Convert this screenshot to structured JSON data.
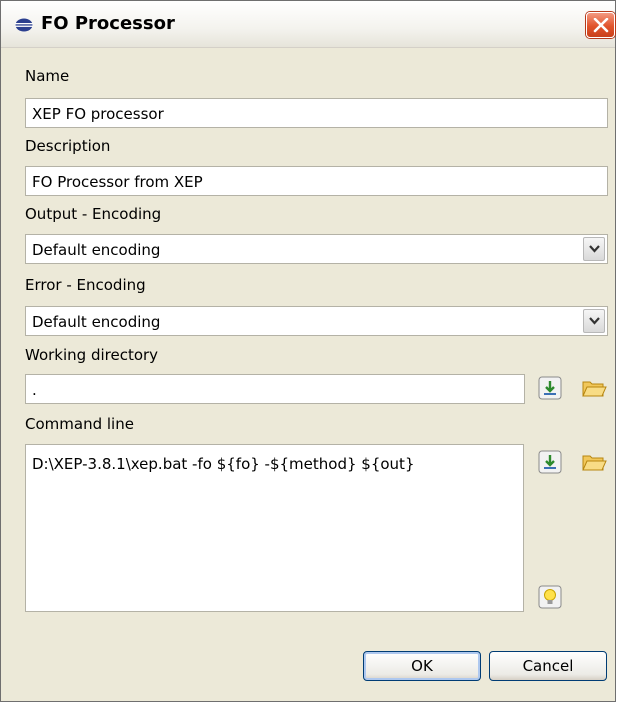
{
  "window": {
    "title": "FO Processor",
    "close_icon": "close-icon"
  },
  "form": {
    "name_label": "Name",
    "name_value": "XEP FO processor",
    "description_label": "Description",
    "description_value": "FO Processor from XEP",
    "output_encoding_label": "Output - Encoding",
    "output_encoding_value": "Default encoding",
    "error_encoding_label": "Error - Encoding",
    "error_encoding_value": "Default encoding",
    "working_directory_label": "Working directory",
    "working_directory_value": ".",
    "command_line_label": "Command line",
    "command_line_value": "D:\\XEP-3.8.1\\xep.bat -fo ${fo} -${method} ${out}"
  },
  "buttons": {
    "ok": "OK",
    "cancel": "Cancel"
  },
  "colors": {
    "accent": "#e1542c",
    "button_border": "#003c74",
    "dialog_bg": "#ece9d8"
  }
}
